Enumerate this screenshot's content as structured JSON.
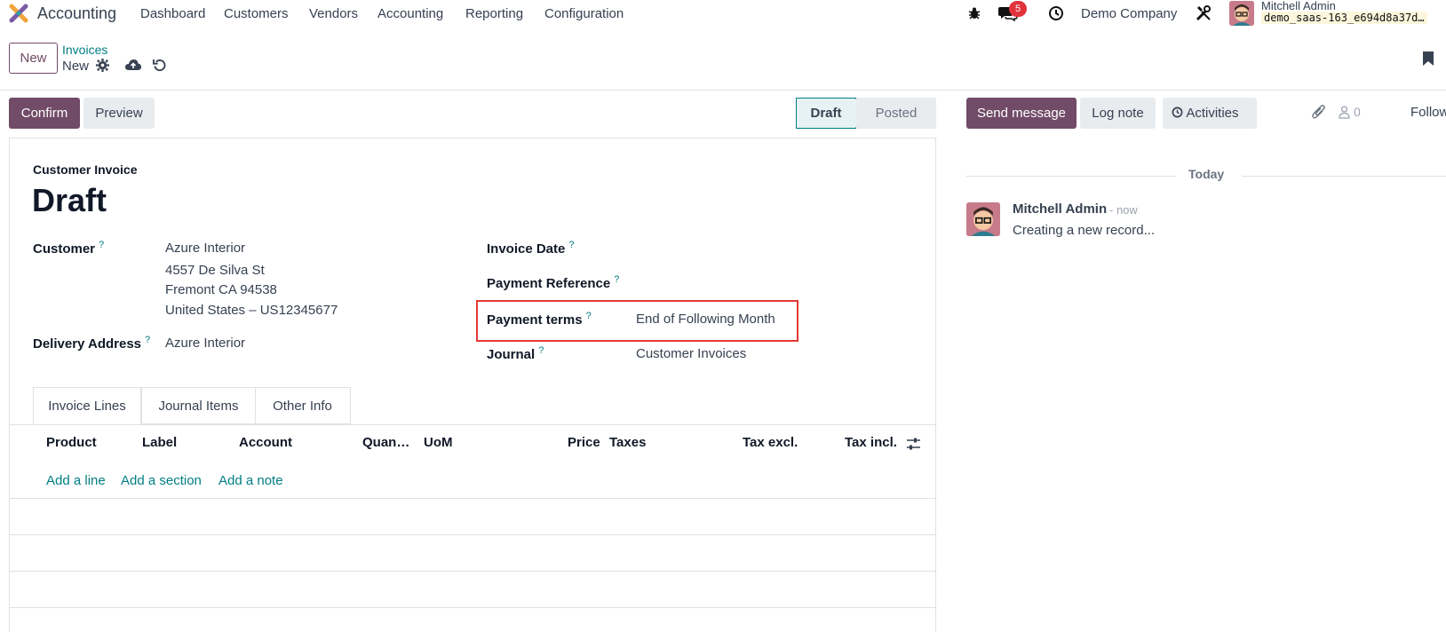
{
  "nav": {
    "app_name": "Accounting",
    "menus": [
      "Dashboard",
      "Customers",
      "Vendors",
      "Accounting",
      "Reporting",
      "Configuration"
    ],
    "message_count": "5",
    "company": "Demo Company",
    "user_name": "Mitchell Admin",
    "db_name": "demo_saas-163_e694d8a37d…"
  },
  "control": {
    "new_label": "New",
    "breadcrumb_parent": "Invoices",
    "breadcrumb_current": "New"
  },
  "actions": {
    "confirm": "Confirm",
    "preview": "Preview",
    "status_draft": "Draft",
    "status_posted": "Posted"
  },
  "chatter": {
    "send_message": "Send message",
    "log_note": "Log note",
    "activities": "Activities",
    "follower_count": "0",
    "follow": "Follow",
    "date_separator": "Today",
    "message_author": "Mitchell Admin",
    "message_time": "- now",
    "message_body": "Creating a new record..."
  },
  "invoice": {
    "type": "Customer Invoice",
    "state": "Draft",
    "customer_label": "Customer",
    "customer_name": "Azure Interior",
    "address_line1": "4557 De Silva St",
    "address_line2": "Fremont CA 94538",
    "address_line3": "United States – US12345677",
    "delivery_label": "Delivery Address",
    "delivery_value": "Azure Interior",
    "invoice_date_label": "Invoice Date",
    "payment_ref_label": "Payment Reference",
    "payment_terms_label": "Payment terms",
    "payment_terms_value": "End of Following Month",
    "journal_label": "Journal",
    "journal_value": "Customer Invoices",
    "help_mark": "?"
  },
  "tabs": [
    "Invoice Lines",
    "Journal Items",
    "Other Info"
  ],
  "lines": {
    "columns": [
      "Product",
      "Label",
      "Account",
      "Quan…",
      "UoM",
      "Price",
      "Taxes",
      "Tax excl.",
      "Tax incl."
    ],
    "add_line": "Add a line",
    "add_section": "Add a section",
    "add_note": "Add a note"
  },
  "colors": {
    "primary": "#714b67",
    "link": "#017e84",
    "highlight": "#e53935"
  }
}
